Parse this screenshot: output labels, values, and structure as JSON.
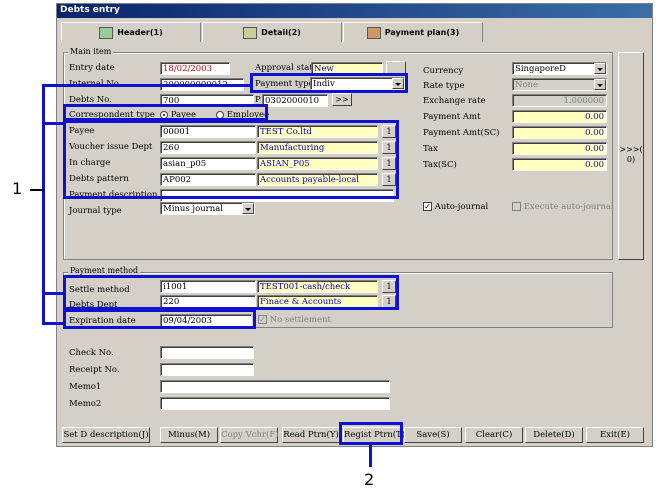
{
  "window": {
    "title": "Debts entry"
  },
  "tabs": [
    {
      "label": "Header(1)"
    },
    {
      "label": "Detail(2)"
    },
    {
      "label": "Payment plan(3)"
    }
  ],
  "main_item": {
    "legend": "Main item",
    "entry_date": {
      "label": "Entry date",
      "value": "18/02/2003"
    },
    "internal_no": {
      "label": "Internal No.",
      "value": "200000000012"
    },
    "debts_no": {
      "label": "Debts No.",
      "value": "700"
    },
    "approval_status": {
      "label": "Approval status",
      "value": "New"
    },
    "payment_type": {
      "label": "Payment type",
      "value": "Indiv"
    },
    "p_value": {
      "label": "P",
      "value": "0302000010"
    },
    "p_button": ">>",
    "correspondent_type": {
      "label": "Correspondent type",
      "opt1": "Payee",
      "opt2": "Employee"
    },
    "payee": {
      "label": "Payee",
      "code": "00001",
      "name": "TEST Co.ltd"
    },
    "voucher_dept": {
      "label": "Voucher issue Dept",
      "code": "260",
      "name": "Manufacturing"
    },
    "in_charge": {
      "label": "In charge",
      "code": "asian_p05",
      "name": "ASIAN_P05"
    },
    "debts_pattern": {
      "label": "Debts pattern",
      "code": "AP002",
      "name": "Accounts payable-local"
    },
    "payment_description": {
      "label": "Payment description",
      "value": ""
    },
    "journal_type": {
      "label": "Journal type",
      "value": "Minus journal"
    },
    "currency": {
      "label": "Currency",
      "value": "SingaporeD"
    },
    "rate_type": {
      "label": "Rate type",
      "value": "None"
    },
    "exchange_rate": {
      "label": "Exchange rate",
      "value": "1.000000"
    },
    "payment_amt": {
      "label": "Payment Amt",
      "value": "0.00"
    },
    "payment_amt_sc": {
      "label": "Payment Amt(SC)",
      "value": "0.00"
    },
    "tax": {
      "label": "Tax",
      "value": "0.00"
    },
    "tax_sc": {
      "label": "Tax(SC)",
      "value": "0.00"
    },
    "auto_journal": "Auto-journal",
    "execute_auto_journal": "Execute auto-journal",
    "side_button": ">>>(\n0)",
    "lookup_btn": "1"
  },
  "payment_method": {
    "legend": "Payment method",
    "settle_method": {
      "label": "Settle method",
      "code": "i1001",
      "name": "TEST001-cash/check"
    },
    "debts_dept": {
      "label": "Debts Dept",
      "code": "220",
      "name": "Finace & Accounts"
    },
    "expiration_date": {
      "label": "Expiration date",
      "value": "09/04/2003"
    },
    "no_settlement": "No settlement"
  },
  "extra": {
    "check_no": "Check No.",
    "receipt_no": "Receipt No.",
    "memo1": "Memo1",
    "memo2": "Memo2"
  },
  "buttons": {
    "set_d_description": "Set D description(J)",
    "minus": "Minus(M)",
    "copy_vchr": "Copy Vchr(F)",
    "read_ptrn": "Read Ptrn(Y)",
    "regist_ptrn": "Regist Ptrn(T)",
    "save": "Save(S)",
    "clear": "Clear(C)",
    "delete": "Delete(D)",
    "exit": "Exit(E)"
  },
  "callouts": {
    "c1": "1",
    "c2": "2"
  }
}
